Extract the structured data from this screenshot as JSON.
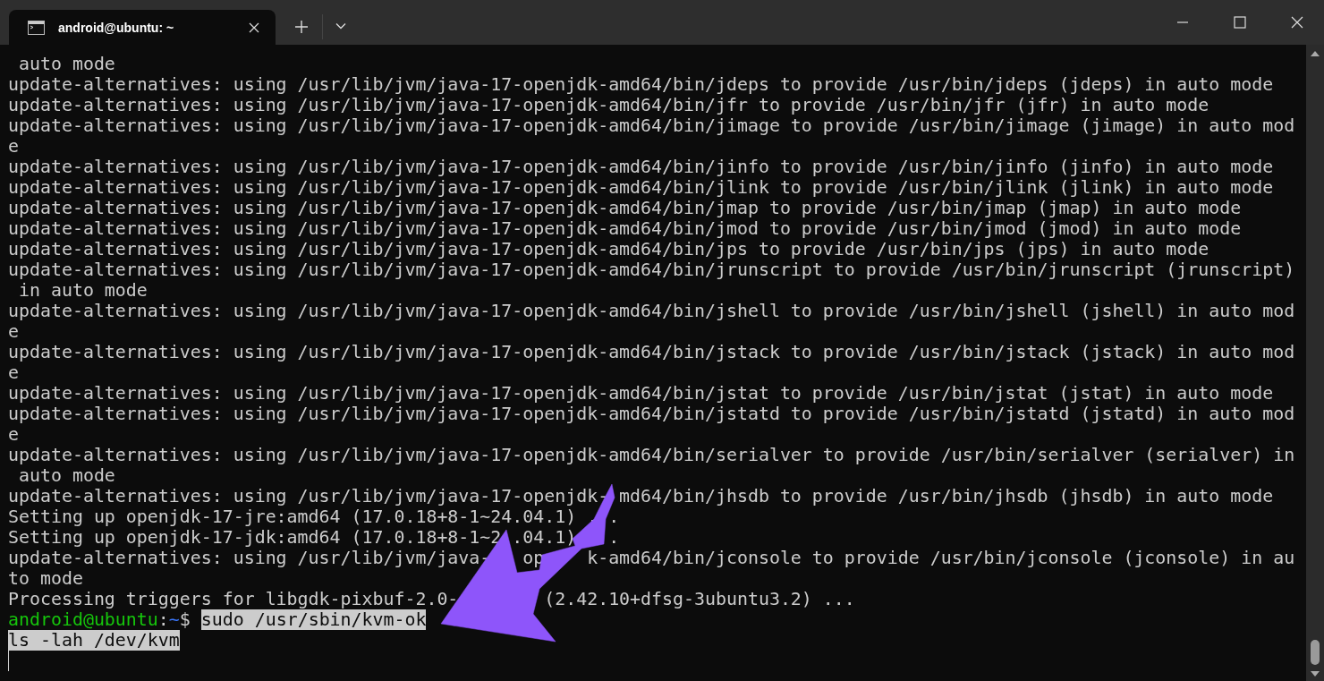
{
  "window": {
    "tab": {
      "title": "android@ubuntu: ~",
      "selected": true
    }
  },
  "terminal": {
    "lines": [
      " auto mode",
      "update-alternatives: using /usr/lib/jvm/java-17-openjdk-amd64/bin/jdeps to provide /usr/bin/jdeps (jdeps) in auto mode",
      "update-alternatives: using /usr/lib/jvm/java-17-openjdk-amd64/bin/jfr to provide /usr/bin/jfr (jfr) in auto mode",
      "update-alternatives: using /usr/lib/jvm/java-17-openjdk-amd64/bin/jimage to provide /usr/bin/jimage (jimage) in auto mod",
      "e",
      "update-alternatives: using /usr/lib/jvm/java-17-openjdk-amd64/bin/jinfo to provide /usr/bin/jinfo (jinfo) in auto mode",
      "update-alternatives: using /usr/lib/jvm/java-17-openjdk-amd64/bin/jlink to provide /usr/bin/jlink (jlink) in auto mode",
      "update-alternatives: using /usr/lib/jvm/java-17-openjdk-amd64/bin/jmap to provide /usr/bin/jmap (jmap) in auto mode",
      "update-alternatives: using /usr/lib/jvm/java-17-openjdk-amd64/bin/jmod to provide /usr/bin/jmod (jmod) in auto mode",
      "update-alternatives: using /usr/lib/jvm/java-17-openjdk-amd64/bin/jps to provide /usr/bin/jps (jps) in auto mode",
      "update-alternatives: using /usr/lib/jvm/java-17-openjdk-amd64/bin/jrunscript to provide /usr/bin/jrunscript (jrunscript)",
      " in auto mode",
      "update-alternatives: using /usr/lib/jvm/java-17-openjdk-amd64/bin/jshell to provide /usr/bin/jshell (jshell) in auto mod",
      "e",
      "update-alternatives: using /usr/lib/jvm/java-17-openjdk-amd64/bin/jstack to provide /usr/bin/jstack (jstack) in auto mod",
      "e",
      "update-alternatives: using /usr/lib/jvm/java-17-openjdk-amd64/bin/jstat to provide /usr/bin/jstat (jstat) in auto mode",
      "update-alternatives: using /usr/lib/jvm/java-17-openjdk-amd64/bin/jstatd to provide /usr/bin/jstatd (jstatd) in auto mod",
      "e",
      "update-alternatives: using /usr/lib/jvm/java-17-openjdk-amd64/bin/serialver to provide /usr/bin/serialver (serialver) in",
      " auto mode",
      "update-alternatives: using /usr/lib/jvm/java-17-openjdk- md64/bin/jhsdb to provide /usr/bin/jhsdb (jhsdb) in auto mode",
      "Setting up openjdk-17-jre:amd64 (17.0.18+8-1~24.04.1) . .",
      "Setting up openjdk-17-jdk:amd64 (17.0.18+8-1~2 .04.1)   .",
      "update-alternatives: using /usr/lib/jvm/java-   op    k-amd64/bin/jconsole to provide /usr/bin/jconsole (jconsole) in au",
      "to mode",
      "Processing triggers for libgdk-pixbuf-2.0-        (2.42.10+dfsg-3ubuntu3.2) ..."
    ],
    "prompt": {
      "user": "android@ubuntu",
      "separator": ":",
      "path": "~",
      "symbol": "$",
      "command": "sudo /usr/sbin/kvm-ok",
      "selected": true
    },
    "input_lines": [
      {
        "text": "ls -lah /dev/kvm",
        "selected": true
      }
    ]
  }
}
